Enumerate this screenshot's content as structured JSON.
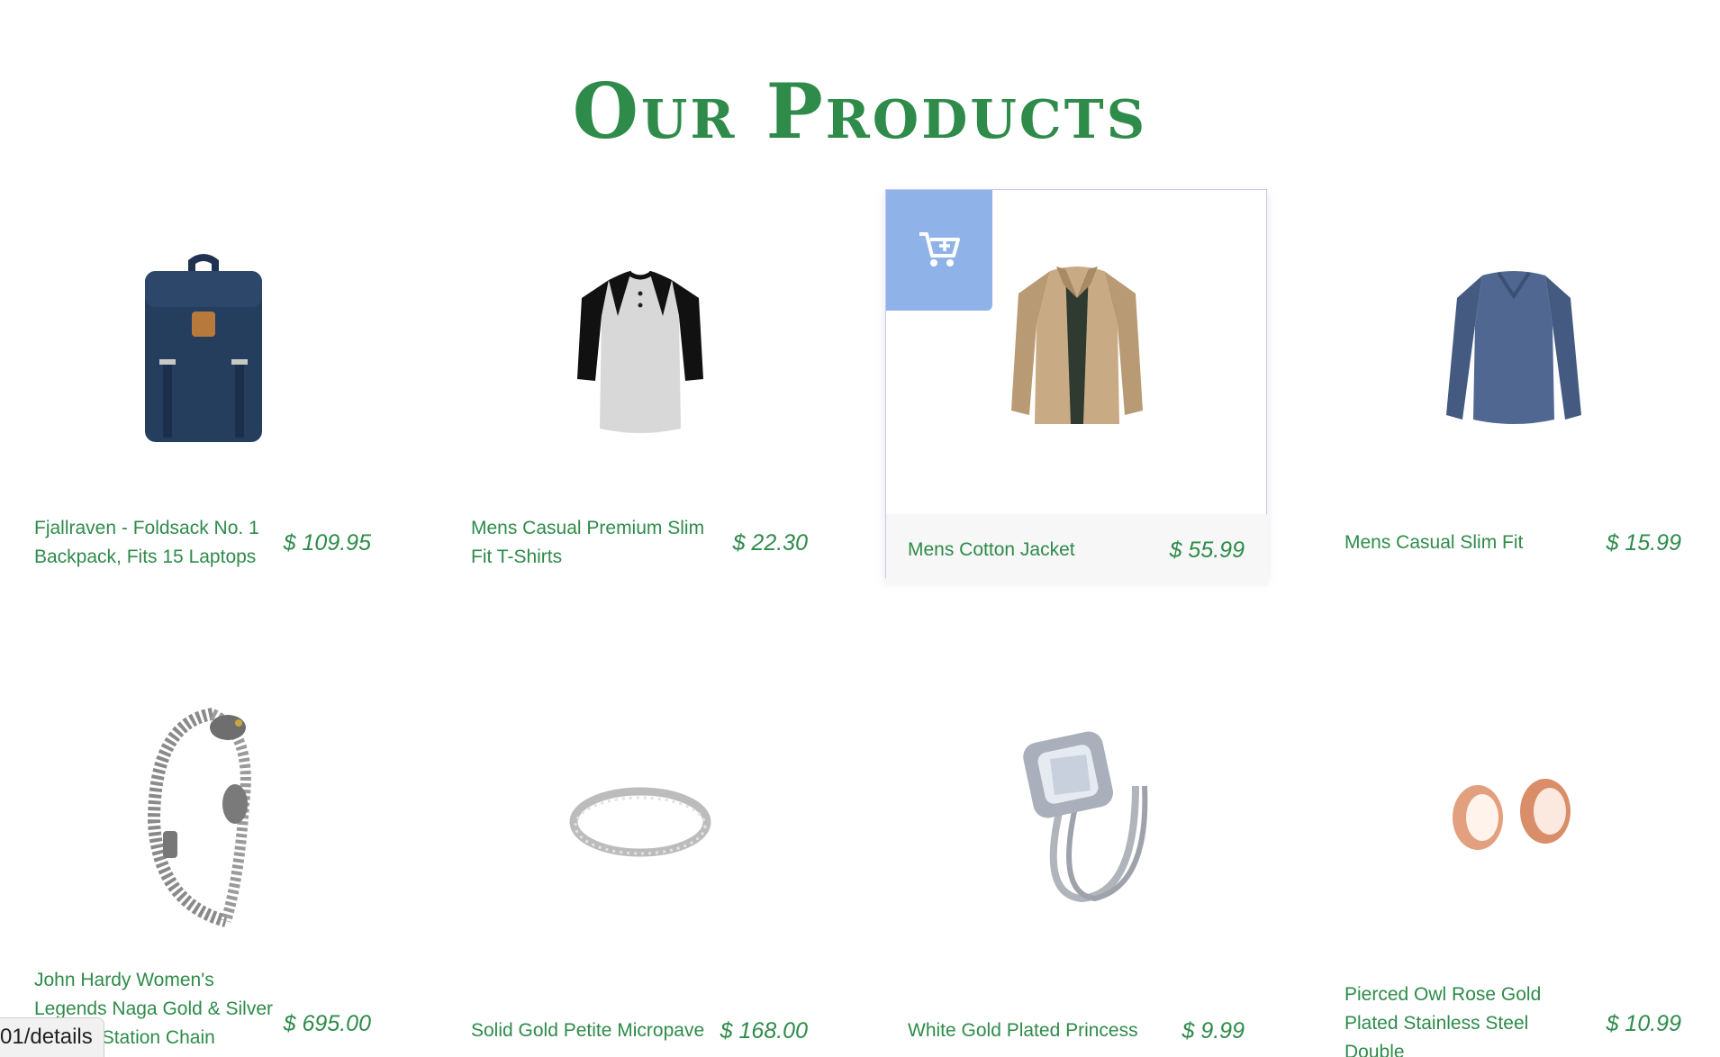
{
  "page": {
    "title": "Our Products"
  },
  "products": [
    {
      "name": "Fjallraven - Foldsack No. 1 Backpack, Fits 15 Laptops",
      "price": "$ 109.95",
      "icon": "backpack"
    },
    {
      "name": "Mens Casual Premium Slim Fit T-Shirts",
      "price": "$ 22.30",
      "icon": "raglan-shirt"
    },
    {
      "name": "Mens Cotton Jacket",
      "price": "$ 55.99",
      "icon": "jacket"
    },
    {
      "name": "Mens Casual Slim Fit",
      "price": "$ 15.99",
      "icon": "long-sleeve-shirt"
    },
    {
      "name": "John Hardy Women's Legends Naga Gold & Silver Dragon Station Chain Bracelet",
      "price": "$ 695.00",
      "icon": "bracelet"
    },
    {
      "name": "Solid Gold Petite Micropave",
      "price": "$ 168.00",
      "icon": "ring-band"
    },
    {
      "name": "White Gold Plated Princess",
      "price": "$ 9.99",
      "icon": "diamond-ring"
    },
    {
      "name": "Pierced Owl Rose Gold Plated Stainless Steel Double",
      "price": "$ 10.99",
      "icon": "ear-tunnels"
    }
  ],
  "hovered_card": {
    "add_to_cart_icon": "cart-plus-icon"
  },
  "status_bar": {
    "url_fragment": "01/details"
  },
  "colors": {
    "accent": "#2e8b4a",
    "badge": "#8fb3e8"
  }
}
